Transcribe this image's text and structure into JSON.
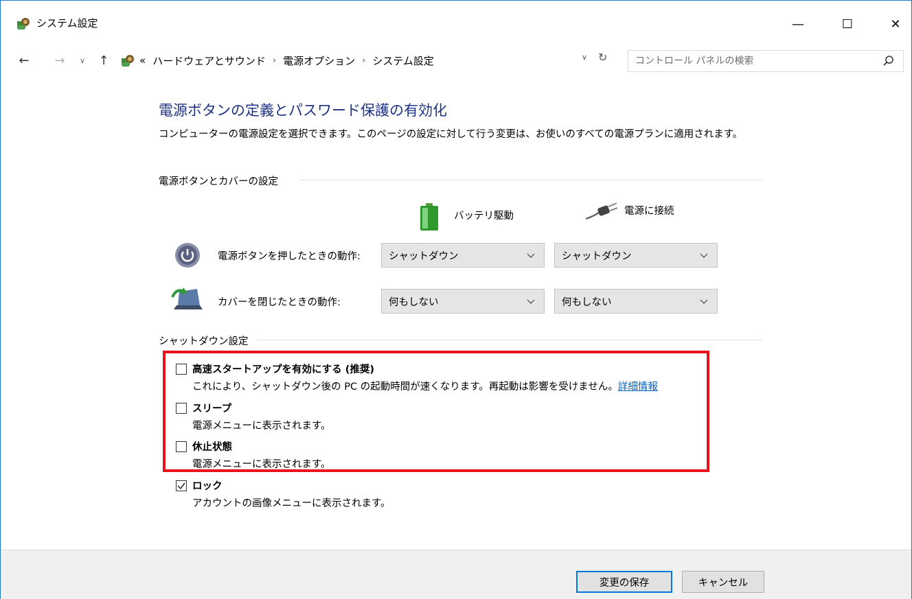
{
  "window": {
    "title": "システム設定",
    "controls": {
      "minimize": "—",
      "maximize": "☐",
      "close": "✕"
    }
  },
  "navigation": {
    "back": "←",
    "forward": "→",
    "recent": "∨",
    "up": "↑",
    "breadcrumb_prefix": "«",
    "breadcrumbs": [
      "ハードウェアとサウンド",
      "電源オプション",
      "システム設定"
    ],
    "separator": "›",
    "search_placeholder": "コントロール パネルの検索"
  },
  "page": {
    "heading": "電源ボタンの定義とパスワード保護の有効化",
    "description": "コンピューターの電源設定を選択できます。このページの設定に対して行う変更は、お使いのすべての電源プランに適用されます。",
    "power_group": {
      "label": "電源ボタンとカバーの設定",
      "columns": {
        "battery": "バッテリ駆動",
        "plugged": "電源に接続"
      },
      "rows": [
        {
          "label": "電源ボタンを押したときの動作:",
          "battery": "シャットダウン",
          "plugged": "シャットダウン"
        },
        {
          "label": "カバーを閉じたときの動作:",
          "battery": "何もしない",
          "plugged": "何もしない"
        }
      ]
    },
    "shutdown_group": {
      "label": "シャットダウン設定",
      "options": [
        {
          "label": "高速スタートアップを有効にする (推奨)",
          "description": "これにより、シャットダウン後の PC の起動時間が速くなります。再起動は影響を受けません。",
          "link": "詳細情報",
          "checked": false
        },
        {
          "label": "スリープ",
          "description": "電源メニューに表示されます。",
          "checked": false
        },
        {
          "label": "休止状態",
          "description": "電源メニューに表示されます。",
          "checked": false
        },
        {
          "label": "ロック",
          "description": "アカウントの画像メニューに表示されます。",
          "checked": true
        }
      ]
    }
  },
  "footer": {
    "save": "変更の保存",
    "cancel": "キャンセル"
  },
  "colors": {
    "heading": "#1e3287",
    "highlight_border": "#e8121d",
    "link": "#0066cc",
    "primary_border": "#0078d7"
  }
}
